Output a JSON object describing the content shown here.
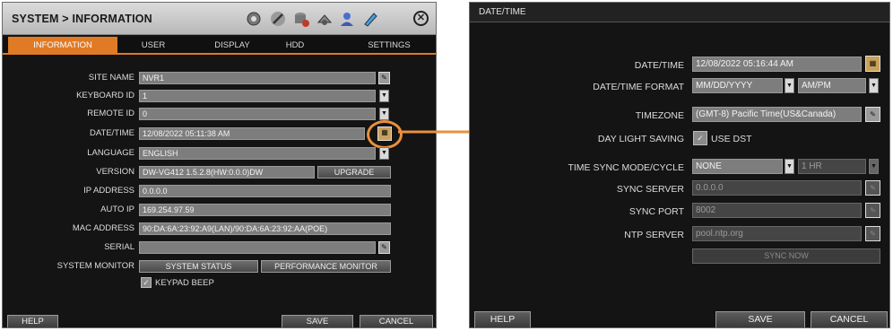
{
  "left_panel": {
    "title": "SYSTEM > INFORMATION",
    "toolbar_icons": [
      "gear-icon",
      "tools-icon",
      "database-icon",
      "network-icon",
      "user-icon",
      "pen-icon"
    ],
    "close_label": "✕",
    "tabs": [
      "INFORMATION",
      "USER",
      "DISPLAY",
      "HDD",
      "SETTINGS"
    ],
    "labels": {
      "site_name": "SITE NAME",
      "keyboard_id": "KEYBOARD ID",
      "remote_id": "REMOTE ID",
      "datetime": "DATE/TIME",
      "language": "LANGUAGE",
      "version": "VERSION",
      "ip_address": "IP ADDRESS",
      "auto_ip": "AUTO IP",
      "mac_address": "MAC ADDRESS",
      "serial": "SERIAL",
      "system_monitor": "SYSTEM MONITOR"
    },
    "values": {
      "site_name": "NVR1",
      "keyboard_id": "1",
      "remote_id": "0",
      "datetime": "12/08/2022 05:11:38 AM",
      "language": "ENGLISH",
      "version": "DW-VG412 1.5.2.8(HW:0.0.0)DW",
      "ip_address": "0.0.0.0",
      "auto_ip": "169.254.97.59",
      "mac_address": "90:DA:6A:23:92:A9(LAN)/90:DA:6A:23:92:AA(POE)",
      "serial": ""
    },
    "buttons": {
      "upgrade": "UPGRADE",
      "system_status": "SYSTEM STATUS",
      "performance_monitor": "PERFORMANCE MONITOR"
    },
    "keypad_beep": {
      "label": "KEYPAD BEEP",
      "checked": true
    },
    "footer": {
      "help": "HELP",
      "save": "SAVE",
      "cancel": "CANCEL"
    }
  },
  "right_panel": {
    "title": "DATE/TIME",
    "labels": {
      "datetime": "DATE/TIME",
      "datetime_format": "DATE/TIME FORMAT",
      "timezone": "TIMEZONE",
      "day_light_saving": "DAY LIGHT SAVING",
      "time_sync_mode": "TIME SYNC MODE/CYCLE",
      "sync_server": "SYNC SERVER",
      "sync_port": "SYNC PORT",
      "ntp_server": "NTP SERVER"
    },
    "values": {
      "datetime": "12/08/2022 05:16:44 AM",
      "date_format": "MM/DD/YYYY",
      "time_format": "AM/PM",
      "timezone": "(GMT-8) Pacific Time(US&Canada)",
      "use_dst": "USE DST",
      "sync_mode": "NONE",
      "sync_cycle": "1 HR",
      "sync_server": "0.0.0.0",
      "sync_port": "8002",
      "ntp_server": "pool.ntp.org"
    },
    "buttons": {
      "sync_now": "SYNC NOW"
    },
    "footer": {
      "help": "HELP",
      "save": "SAVE",
      "cancel": "CANCEL"
    }
  },
  "colors": {
    "accent": "#e07a24",
    "panel_bg": "#141414",
    "field_bg": "#7d7d7d",
    "arrow": "#e8913e"
  }
}
